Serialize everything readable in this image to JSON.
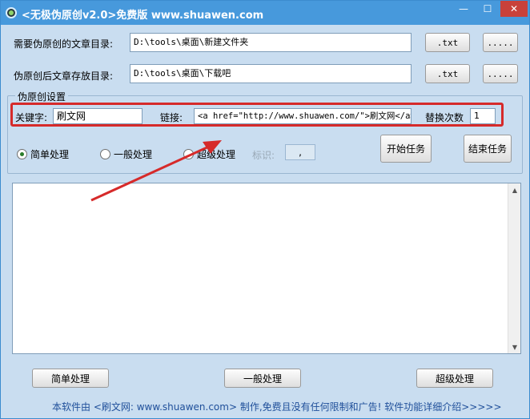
{
  "window": {
    "title": "<无极伪原创v2.0>免费版 www.shuawen.com",
    "minimize_symbol": "—",
    "maximize_symbol": "☐",
    "close_symbol": "✕"
  },
  "source_dir": {
    "label": "需要伪原创的文章目录:",
    "value": "D:\\tools\\桌面\\新建文件夹",
    "ext": ".txt",
    "browse": "....."
  },
  "output_dir": {
    "label": "伪原创后文章存放目录:",
    "value": "D:\\tools\\桌面\\下载吧",
    "ext": ".txt",
    "browse": "....."
  },
  "settings": {
    "group_title": "伪原创设置",
    "keyword_label": "关键字:",
    "keyword_value": "刷文网",
    "link_label": "链接:",
    "link_value": "<a href=\"http://www.shuawen.com/\">刷文网</a>",
    "replace_count_label": "替换次数",
    "replace_count_value": "1",
    "radio_simple": "简单处理",
    "radio_general": "一般处理",
    "radio_super": "超级处理",
    "mark_label": "标识:",
    "mark_value": ",",
    "start_button": "开始任务",
    "stop_button": "结束任务"
  },
  "bottom_buttons": {
    "simple": "简单处理",
    "general": "一般处理",
    "super": "超级处理"
  },
  "footer": {
    "text": "本软件由 <刷文网: www.shuawen.com> 制作,免费且没有任何限制和广告! 软件功能详细介绍>>>>>"
  },
  "colors": {
    "titlebar": "#4799dc",
    "window_bg": "#c9ddf0",
    "highlight_red": "#d62a2a",
    "footer_text": "#1f4f9a"
  }
}
